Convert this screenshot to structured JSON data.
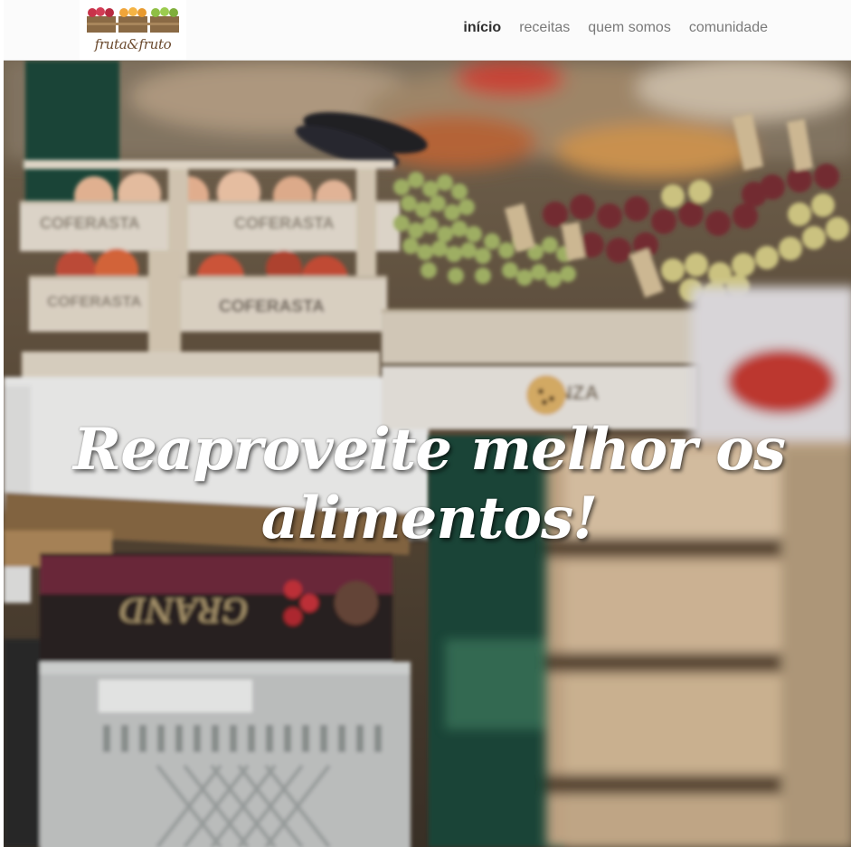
{
  "brand": {
    "name": "fruta&fruto",
    "logo_icon": "fruit-crates-icon",
    "colors": {
      "crate_wood": "#8a6a45",
      "red_fruit": "#c8324a",
      "orange_fruit": "#f0a53a",
      "green_fruit": "#8fbf45",
      "text": "#6b4a2e"
    }
  },
  "nav": {
    "items": [
      {
        "label": "início",
        "active": true
      },
      {
        "label": "receitas",
        "active": false
      },
      {
        "label": "quem somos",
        "active": false
      },
      {
        "label": "comunidade",
        "active": false
      }
    ]
  },
  "hero": {
    "headline": "Reaproveite melhor os alimentos!",
    "background": "market-fruit-crates-photo",
    "crate_labels": [
      "COFERASTA",
      "COFERASTA",
      "COFERASTA",
      "BONZA",
      "GRAND"
    ]
  }
}
